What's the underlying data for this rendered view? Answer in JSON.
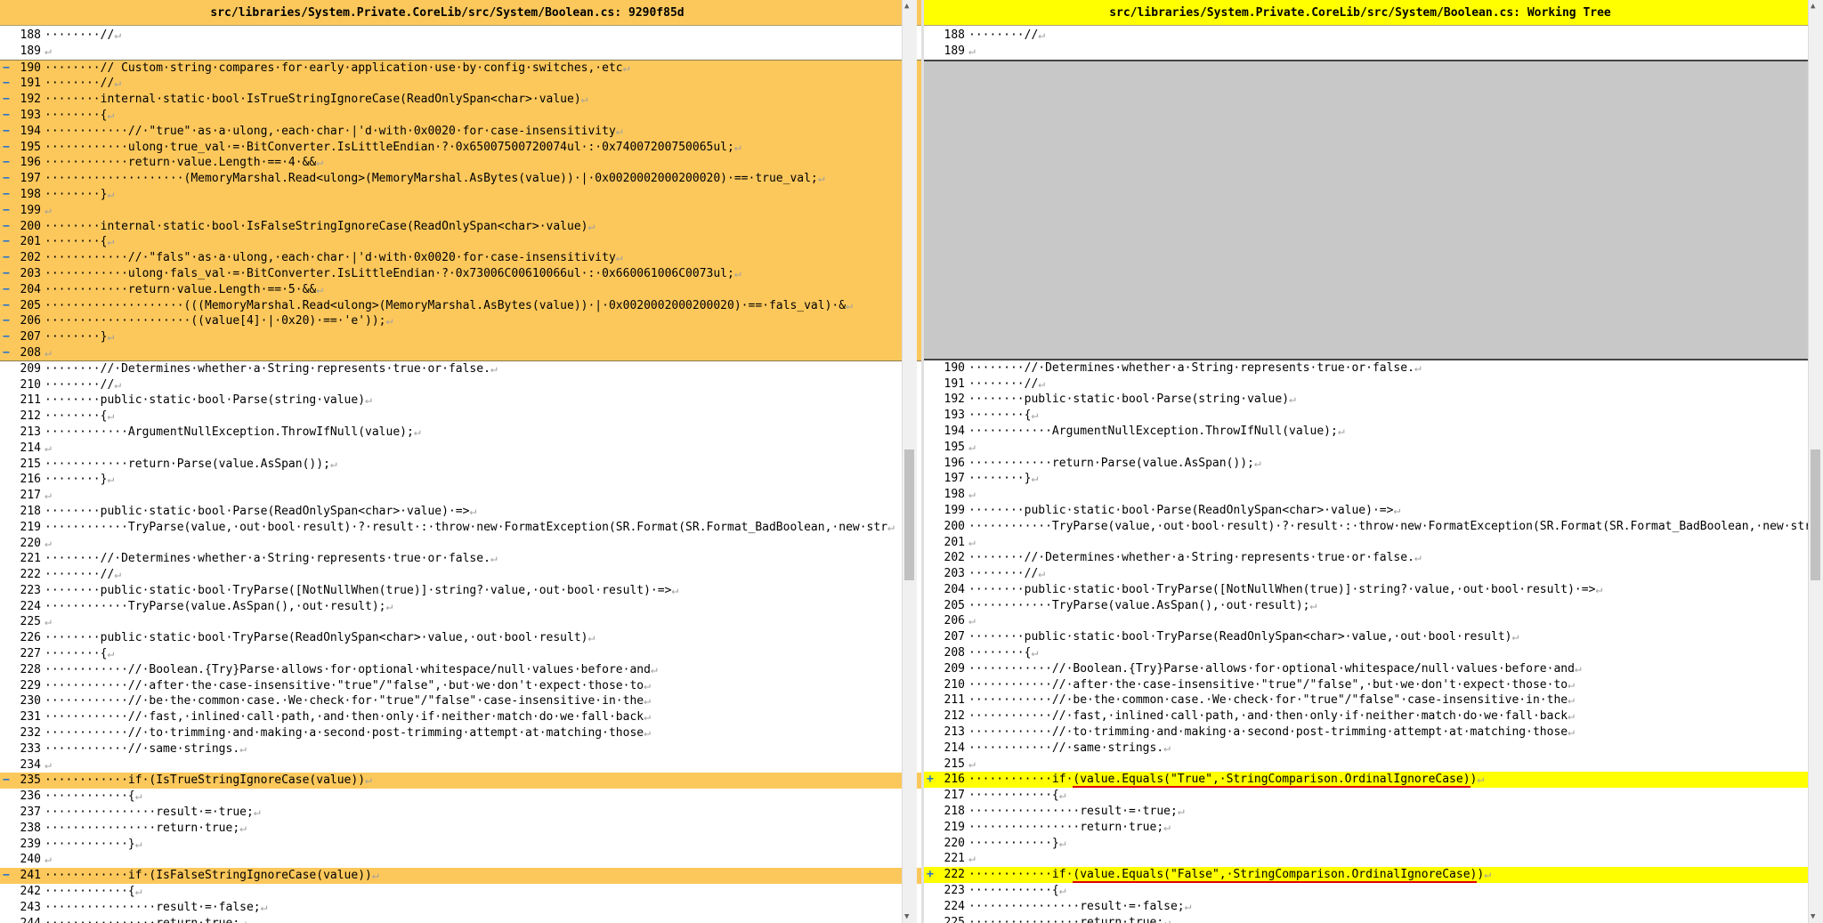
{
  "left": {
    "title": "src/libraries/System.Private.CoreLib/src/System/Boolean.cs: 9290f85d",
    "lines": [
      {
        "n": "188",
        "type": "normal",
        "code": "········//"
      },
      {
        "n": "189",
        "type": "normal",
        "code": ""
      },
      {
        "n": "190",
        "type": "removed",
        "code": "········// Custom·string·compares·for·early·application·use·by·config·switches,·etc"
      },
      {
        "n": "191",
        "type": "removed",
        "code": "········//"
      },
      {
        "n": "192",
        "type": "removed",
        "code": "········internal·static·bool·IsTrueStringIgnoreCase(ReadOnlySpan<char>·value)"
      },
      {
        "n": "193",
        "type": "removed",
        "code": "········{"
      },
      {
        "n": "194",
        "type": "removed",
        "code": "············//·\"true\"·as·a·ulong,·each·char·|'d·with·0x0020·for·case-insensitivity"
      },
      {
        "n": "195",
        "type": "removed",
        "code": "············ulong·true_val·=·BitConverter.IsLittleEndian·?·0x65007500720074ul·:·0x74007200750065ul;"
      },
      {
        "n": "196",
        "type": "removed",
        "code": "············return·value.Length·==·4·&&"
      },
      {
        "n": "197",
        "type": "removed",
        "code": "····················(MemoryMarshal.Read<ulong>(MemoryMarshal.AsBytes(value))·|·0x0020002000200020)·==·true_val;"
      },
      {
        "n": "198",
        "type": "removed",
        "code": "········}"
      },
      {
        "n": "199",
        "type": "removed",
        "code": ""
      },
      {
        "n": "200",
        "type": "removed",
        "code": "········internal·static·bool·IsFalseStringIgnoreCase(ReadOnlySpan<char>·value)"
      },
      {
        "n": "201",
        "type": "removed",
        "code": "········{"
      },
      {
        "n": "202",
        "type": "removed",
        "code": "············//·\"fals\"·as·a·ulong,·each·char·|'d·with·0x0020·for·case-insensitivity"
      },
      {
        "n": "203",
        "type": "removed",
        "code": "············ulong·fals_val·=·BitConverter.IsLittleEndian·?·0x73006C00610066ul·:·0x660061006C0073ul;"
      },
      {
        "n": "204",
        "type": "removed",
        "code": "············return·value.Length·==·5·&&"
      },
      {
        "n": "205",
        "type": "removed",
        "code": "····················(((MemoryMarshal.Read<ulong>(MemoryMarshal.AsBytes(value))·|·0x0020002000200020)·==·fals_val)·&"
      },
      {
        "n": "206",
        "type": "removed",
        "code": "·····················((value[4]·|·0x20)·==·'e'));"
      },
      {
        "n": "207",
        "type": "removed",
        "code": "········}"
      },
      {
        "n": "208",
        "type": "removed",
        "code": ""
      },
      {
        "n": "209",
        "type": "normal",
        "code": "········//·Determines·whether·a·String·represents·true·or·false."
      },
      {
        "n": "210",
        "type": "normal",
        "code": "········//"
      },
      {
        "n": "211",
        "type": "normal",
        "code": "········public·static·bool·Parse(string·value)"
      },
      {
        "n": "212",
        "type": "normal",
        "code": "········{"
      },
      {
        "n": "213",
        "type": "normal",
        "code": "············ArgumentNullException.ThrowIfNull(value);"
      },
      {
        "n": "214",
        "type": "normal",
        "code": ""
      },
      {
        "n": "215",
        "type": "normal",
        "code": "············return·Parse(value.AsSpan());"
      },
      {
        "n": "216",
        "type": "normal",
        "code": "········}"
      },
      {
        "n": "217",
        "type": "normal",
        "code": ""
      },
      {
        "n": "218",
        "type": "normal",
        "code": "········public·static·bool·Parse(ReadOnlySpan<char>·value)·=>"
      },
      {
        "n": "219",
        "type": "normal",
        "code": "············TryParse(value,·out·bool·result)·?·result·:·throw·new·FormatException(SR.Format(SR.Format_BadBoolean,·new·str"
      },
      {
        "n": "220",
        "type": "normal",
        "code": ""
      },
      {
        "n": "221",
        "type": "normal",
        "code": "········//·Determines·whether·a·String·represents·true·or·false."
      },
      {
        "n": "222",
        "type": "normal",
        "code": "········//"
      },
      {
        "n": "223",
        "type": "normal",
        "code": "········public·static·bool·TryParse([NotNullWhen(true)]·string?·value,·out·bool·result)·=>"
      },
      {
        "n": "224",
        "type": "normal",
        "code": "············TryParse(value.AsSpan(),·out·result);"
      },
      {
        "n": "225",
        "type": "normal",
        "code": ""
      },
      {
        "n": "226",
        "type": "normal",
        "code": "········public·static·bool·TryParse(ReadOnlySpan<char>·value,·out·bool·result)"
      },
      {
        "n": "227",
        "type": "normal",
        "code": "········{"
      },
      {
        "n": "228",
        "type": "normal",
        "code": "············//·Boolean.{Try}Parse·allows·for·optional·whitespace/null·values·before·and"
      },
      {
        "n": "229",
        "type": "normal",
        "code": "············//·after·the·case-insensitive·\"true\"/\"false\",·but·we·don't·expect·those·to"
      },
      {
        "n": "230",
        "type": "normal",
        "code": "············//·be·the·common·case.·We·check·for·\"true\"/\"false\"·case-insensitive·in·the"
      },
      {
        "n": "231",
        "type": "normal",
        "code": "············//·fast,·inlined·call·path,·and·then·only·if·neither·match·do·we·fall·back"
      },
      {
        "n": "232",
        "type": "normal",
        "code": "············//·to·trimming·and·making·a·second·post-trimming·attempt·at·matching·those"
      },
      {
        "n": "233",
        "type": "normal",
        "code": "············//·same·strings."
      },
      {
        "n": "234",
        "type": "normal",
        "code": ""
      },
      {
        "n": "235",
        "type": "removed",
        "code": "············if·(IsTrueStringIgnoreCase(value))"
      },
      {
        "n": "236",
        "type": "normal",
        "code": "············{"
      },
      {
        "n": "237",
        "type": "normal",
        "code": "················result·=·true;"
      },
      {
        "n": "238",
        "type": "normal",
        "code": "················return·true;"
      },
      {
        "n": "239",
        "type": "normal",
        "code": "············}"
      },
      {
        "n": "240",
        "type": "normal",
        "code": ""
      },
      {
        "n": "241",
        "type": "removed",
        "code": "············if·(IsFalseStringIgnoreCase(value))"
      },
      {
        "n": "242",
        "type": "normal",
        "code": "············{"
      },
      {
        "n": "243",
        "type": "normal",
        "code": "················result·=·false;"
      },
      {
        "n": "244",
        "type": "normal",
        "code": "················return·true;"
      }
    ]
  },
  "right": {
    "title": "src/libraries/System.Private.CoreLib/src/System/Boolean.cs: Working Tree",
    "lines": [
      {
        "n": "188",
        "type": "normal",
        "code": "········//"
      },
      {
        "n": "189",
        "type": "normal",
        "code": ""
      },
      {
        "n": "",
        "type": "filler",
        "code": ""
      },
      {
        "n": "",
        "type": "filler",
        "code": ""
      },
      {
        "n": "",
        "type": "filler",
        "code": ""
      },
      {
        "n": "",
        "type": "filler",
        "code": ""
      },
      {
        "n": "",
        "type": "filler",
        "code": ""
      },
      {
        "n": "",
        "type": "filler",
        "code": ""
      },
      {
        "n": "",
        "type": "filler",
        "code": ""
      },
      {
        "n": "",
        "type": "filler",
        "code": ""
      },
      {
        "n": "",
        "type": "filler",
        "code": ""
      },
      {
        "n": "",
        "type": "filler",
        "code": ""
      },
      {
        "n": "",
        "type": "filler",
        "code": ""
      },
      {
        "n": "",
        "type": "filler",
        "code": ""
      },
      {
        "n": "",
        "type": "filler",
        "code": ""
      },
      {
        "n": "",
        "type": "filler",
        "code": ""
      },
      {
        "n": "",
        "type": "filler",
        "code": ""
      },
      {
        "n": "",
        "type": "filler",
        "code": ""
      },
      {
        "n": "",
        "type": "filler",
        "code": ""
      },
      {
        "n": "",
        "type": "filler",
        "code": ""
      },
      {
        "n": "",
        "type": "filler",
        "code": ""
      },
      {
        "n": "190",
        "type": "normal",
        "code": "········//·Determines·whether·a·String·represents·true·or·false."
      },
      {
        "n": "191",
        "type": "normal",
        "code": "········//"
      },
      {
        "n": "192",
        "type": "normal",
        "code": "········public·static·bool·Parse(string·value)"
      },
      {
        "n": "193",
        "type": "normal",
        "code": "········{"
      },
      {
        "n": "194",
        "type": "normal",
        "code": "············ArgumentNullException.ThrowIfNull(value);"
      },
      {
        "n": "195",
        "type": "normal",
        "code": ""
      },
      {
        "n": "196",
        "type": "normal",
        "code": "············return·Parse(value.AsSpan());"
      },
      {
        "n": "197",
        "type": "normal",
        "code": "········}"
      },
      {
        "n": "198",
        "type": "normal",
        "code": ""
      },
      {
        "n": "199",
        "type": "normal",
        "code": "········public·static·bool·Parse(ReadOnlySpan<char>·value)·=>"
      },
      {
        "n": "200",
        "type": "normal",
        "code": "············TryParse(value,·out·bool·result)·?·result·:·throw·new·FormatException(SR.Format(SR.Format_BadBoolean,·new·str"
      },
      {
        "n": "201",
        "type": "normal",
        "code": ""
      },
      {
        "n": "202",
        "type": "normal",
        "code": "········//·Determines·whether·a·String·represents·true·or·false."
      },
      {
        "n": "203",
        "type": "normal",
        "code": "········//"
      },
      {
        "n": "204",
        "type": "normal",
        "code": "········public·static·bool·TryParse([NotNullWhen(true)]·string?·value,·out·bool·result)·=>"
      },
      {
        "n": "205",
        "type": "normal",
        "code": "············TryParse(value.AsSpan(),·out·result);"
      },
      {
        "n": "206",
        "type": "normal",
        "code": ""
      },
      {
        "n": "207",
        "type": "normal",
        "code": "········public·static·bool·TryParse(ReadOnlySpan<char>·value,·out·bool·result)"
      },
      {
        "n": "208",
        "type": "normal",
        "code": "········{"
      },
      {
        "n": "209",
        "type": "normal",
        "code": "············//·Boolean.{Try}Parse·allows·for·optional·whitespace/null·values·before·and"
      },
      {
        "n": "210",
        "type": "normal",
        "code": "············//·after·the·case-insensitive·\"true\"/\"false\",·but·we·don't·expect·those·to"
      },
      {
        "n": "211",
        "type": "normal",
        "code": "············//·be·the·common·case.·We·check·for·\"true\"/\"false\"·case-insensitive·in·the"
      },
      {
        "n": "212",
        "type": "normal",
        "code": "············//·fast,·inlined·call·path,·and·then·only·if·neither·match·do·we·fall·back"
      },
      {
        "n": "213",
        "type": "normal",
        "code": "············//·to·trimming·and·making·a·second·post-trimming·attempt·at·matching·those"
      },
      {
        "n": "214",
        "type": "normal",
        "code": "············//·same·strings."
      },
      {
        "n": "215",
        "type": "normal",
        "code": ""
      },
      {
        "n": "216",
        "type": "added",
        "code": "············if·",
        "ul": "(value.Equals(\"True\",·StringComparison.OrdinalIgnoreCase)",
        "tail": ")"
      },
      {
        "n": "217",
        "type": "normal",
        "code": "············{"
      },
      {
        "n": "218",
        "type": "normal",
        "code": "················result·=·true;"
      },
      {
        "n": "219",
        "type": "normal",
        "code": "················return·true;"
      },
      {
        "n": "220",
        "type": "normal",
        "code": "············}"
      },
      {
        "n": "221",
        "type": "normal",
        "code": ""
      },
      {
        "n": "222",
        "type": "added",
        "code": "············if·",
        "ul": "(value.Equals(\"False\",·StringComparison.OrdinalIgnoreCase)",
        "tail": ")"
      },
      {
        "n": "223",
        "type": "normal",
        "code": "············{"
      },
      {
        "n": "224",
        "type": "normal",
        "code": "················result·=·false;"
      },
      {
        "n": "225",
        "type": "normal",
        "code": "················return·true;"
      }
    ]
  },
  "markers": {
    "removed": "−",
    "added": "+",
    "eol": "↵"
  },
  "colors": {
    "removed": "#fcc85c",
    "added": "#ffff00",
    "filler": "#c8c8c8",
    "underline": "#e00000"
  }
}
